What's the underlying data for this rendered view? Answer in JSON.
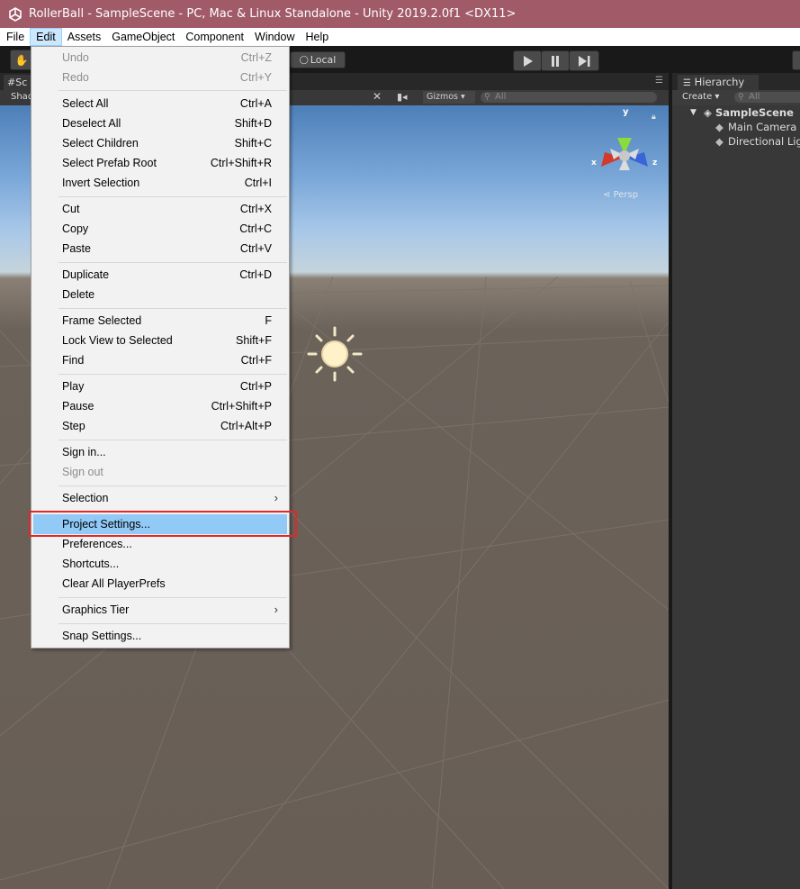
{
  "window": {
    "title": "RollerBall - SampleScene - PC, Mac & Linux Standalone - Unity 2019.2.0f1 <DX11>"
  },
  "menubar": {
    "items": [
      "File",
      "Edit",
      "Assets",
      "GameObject",
      "Component",
      "Window",
      "Help"
    ],
    "active": "Edit"
  },
  "toolbar": {
    "pivot_space_label": "Local",
    "play_icon": "play-icon",
    "pause_icon": "pause-icon",
    "step_icon": "step-icon"
  },
  "scene": {
    "tab_label": "Sc",
    "shading_label": "Shad",
    "gizmos_label": "Gizmos",
    "search_placeholder": "All",
    "persp_label": "Persp",
    "axis_labels": {
      "x": "x",
      "y": "y",
      "z": "z"
    },
    "sky_color": "#7aa7d8",
    "ground_color": "#685e56"
  },
  "hierarchy": {
    "tab_label": "Hierarchy",
    "create_label": "Create",
    "search_placeholder": "All",
    "scene_name": "SampleScene",
    "objects": [
      "Main Camera",
      "Directional Lig"
    ]
  },
  "edit_menu": {
    "items": [
      {
        "label": "Undo",
        "shortcut": "Ctrl+Z",
        "disabled": true
      },
      {
        "label": "Redo",
        "shortcut": "Ctrl+Y",
        "disabled": true
      },
      {
        "label": "Select All",
        "shortcut": "Ctrl+A"
      },
      {
        "label": "Deselect All",
        "shortcut": "Shift+D"
      },
      {
        "label": "Select Children",
        "shortcut": "Shift+C"
      },
      {
        "label": "Select Prefab Root",
        "shortcut": "Ctrl+Shift+R"
      },
      {
        "label": "Invert Selection",
        "shortcut": "Ctrl+I"
      },
      {
        "label": "Cut",
        "shortcut": "Ctrl+X"
      },
      {
        "label": "Copy",
        "shortcut": "Ctrl+C"
      },
      {
        "label": "Paste",
        "shortcut": "Ctrl+V"
      },
      {
        "label": "Duplicate",
        "shortcut": "Ctrl+D"
      },
      {
        "label": "Delete",
        "shortcut": ""
      },
      {
        "label": "Frame Selected",
        "shortcut": "F"
      },
      {
        "label": "Lock View to Selected",
        "shortcut": "Shift+F"
      },
      {
        "label": "Find",
        "shortcut": "Ctrl+F"
      },
      {
        "label": "Play",
        "shortcut": "Ctrl+P"
      },
      {
        "label": "Pause",
        "shortcut": "Ctrl+Shift+P"
      },
      {
        "label": "Step",
        "shortcut": "Ctrl+Alt+P"
      },
      {
        "label": "Sign in...",
        "shortcut": ""
      },
      {
        "label": "Sign out",
        "shortcut": "",
        "disabled": true
      },
      {
        "label": "Selection",
        "shortcut": "",
        "submenu": true
      },
      {
        "label": "Project Settings...",
        "shortcut": "",
        "highlighted": true
      },
      {
        "label": "Preferences...",
        "shortcut": ""
      },
      {
        "label": "Shortcuts...",
        "shortcut": ""
      },
      {
        "label": "Clear All PlayerPrefs",
        "shortcut": ""
      },
      {
        "label": "Graphics Tier",
        "shortcut": "",
        "submenu": true
      },
      {
        "label": "Snap Settings...",
        "shortcut": ""
      }
    ]
  },
  "colors": {
    "titlebar": "#a05a68",
    "menu_highlight": "#91c9f7",
    "annotation_box": "#e02828"
  }
}
